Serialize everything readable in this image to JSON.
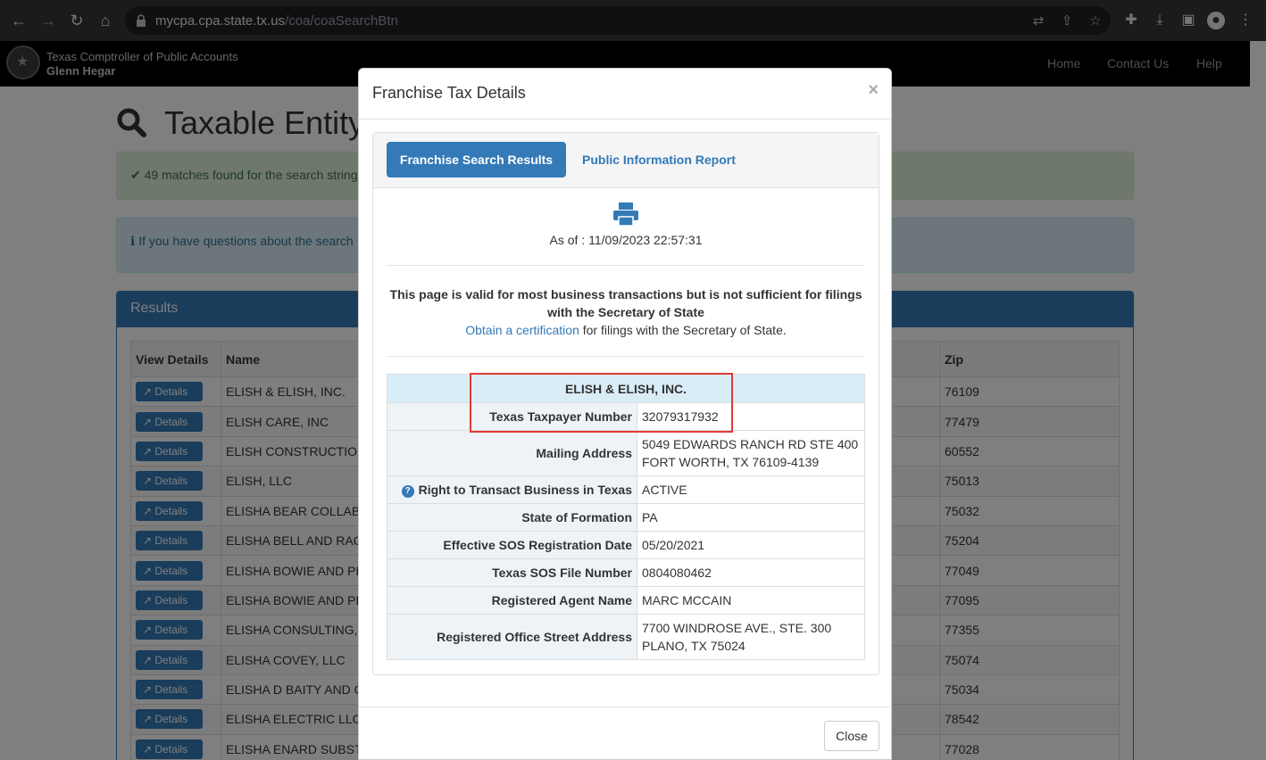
{
  "browser": {
    "url_host": "mycpa.cpa.state.tx.us",
    "url_path": "/coa/coaSearchBtn"
  },
  "site": {
    "org_name": "Texas Comptroller of Public Accounts",
    "official": "Glenn Hegar",
    "nav": [
      "Home",
      "Contact Us",
      "Help"
    ]
  },
  "page": {
    "title": "Taxable Entity",
    "success_msg": "49 matches found for the search string",
    "info_msg": "If you have questions about the search",
    "results_heading": "Results",
    "columns": [
      "View Details",
      "Name",
      "Zip"
    ],
    "details_label": "Details",
    "rows": [
      {
        "name": "ELISH & ELISH, INC.",
        "zip": "76109"
      },
      {
        "name": "ELISH CARE, INC",
        "zip": "77479"
      },
      {
        "name": "ELISH CONSTRUCTIO",
        "zip": "60552"
      },
      {
        "name": "ELISH, LLC",
        "zip": "75013"
      },
      {
        "name": "ELISHA BEAR COLLAB",
        "zip": "75032"
      },
      {
        "name": "ELISHA BELL AND RAC",
        "zip": "75204"
      },
      {
        "name": "ELISHA BOWIE AND PE",
        "zip": "77049"
      },
      {
        "name": "ELISHA BOWIE AND PE",
        "zip": "77095"
      },
      {
        "name": "ELISHA CONSULTING,",
        "zip": "77355"
      },
      {
        "name": "ELISHA COVEY, LLC",
        "zip": "75074"
      },
      {
        "name": "ELISHA D BAITY AND C",
        "zip": "75034"
      },
      {
        "name": "ELISHA ELECTRIC LLC",
        "zip": "78542"
      },
      {
        "name": "ELISHA ENARD SUBST",
        "zip": "77028"
      }
    ]
  },
  "modal": {
    "title": "Franchise Tax Details",
    "close_x": "×",
    "tab_active": "Franchise Search Results",
    "tab_other": "Public Information Report",
    "as_of": "As of : 11/09/2023 22:57:31",
    "note_bold": "This page is valid for most business transactions but is not sufficient for filings with the Secretary of State",
    "note_link": "Obtain a certification",
    "note_rest": " for filings with the Secretary of State.",
    "entity_name": "ELISH & ELISH, INC.",
    "details": [
      {
        "label": "Texas Taxpayer Number",
        "value": [
          "32079317932"
        ]
      },
      {
        "label": "Mailing Address",
        "value": [
          "5049 EDWARDS RANCH RD STE 400",
          "FORT WORTH, TX 76109-4139"
        ]
      },
      {
        "label": "Right to Transact Business in Texas",
        "value": [
          "ACTIVE"
        ],
        "help": true
      },
      {
        "label": "State of Formation",
        "value": [
          "PA"
        ]
      },
      {
        "label": "Effective SOS Registration Date",
        "value": [
          "05/20/2021"
        ]
      },
      {
        "label": "Texas SOS File Number",
        "value": [
          "0804080462"
        ]
      },
      {
        "label": "Registered Agent Name",
        "value": [
          "MARC MCCAIN"
        ]
      },
      {
        "label": "Registered Office Street Address",
        "value": [
          "7700 WINDROSE AVE., STE. 300",
          "PLANO, TX 75024"
        ]
      }
    ],
    "close_button": "Close"
  }
}
